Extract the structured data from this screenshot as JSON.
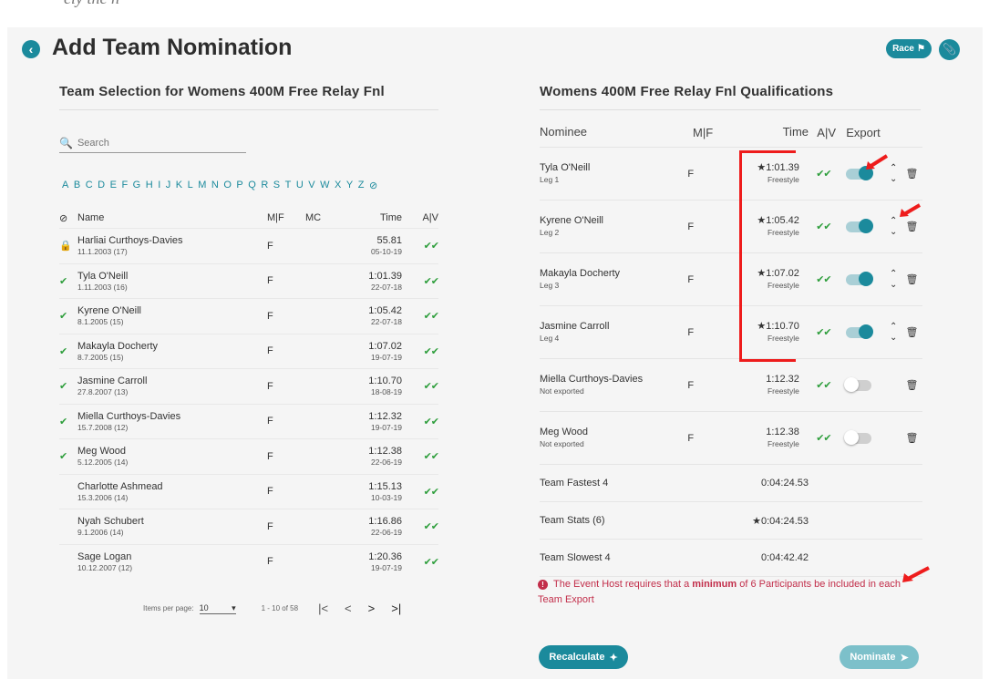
{
  "header": {
    "title": "Add Team Nomination",
    "race_label": "Race",
    "top_fragment": "ely  the  n"
  },
  "left": {
    "section_title": "Team Selection for Womens 400M Free Relay Fnl",
    "search_placeholder": "Search",
    "alphabet": [
      "A",
      "B",
      "C",
      "D",
      "E",
      "F",
      "G",
      "H",
      "I",
      "J",
      "K",
      "L",
      "M",
      "N",
      "O",
      "P",
      "Q",
      "R",
      "S",
      "T",
      "U",
      "V",
      "W",
      "X",
      "Y",
      "Z"
    ],
    "columns": {
      "name": "Name",
      "mf": "M|F",
      "mc": "MC",
      "time": "Time",
      "av": "A|V"
    },
    "rows": [
      {
        "name": "Harliai Curthoys-Davies",
        "dob": "11.1.2003 (17)",
        "mf": "F",
        "mc": "",
        "time": "55.81",
        "date": "05-10-19",
        "icon": "lock"
      },
      {
        "name": "Tyla O'Neill",
        "dob": "1.11.2003 (16)",
        "mf": "F",
        "mc": "",
        "time": "1:01.39",
        "date": "22-07-18",
        "icon": "check"
      },
      {
        "name": "Kyrene O'Neill",
        "dob": "8.1.2005 (15)",
        "mf": "F",
        "mc": "",
        "time": "1:05.42",
        "date": "22-07-18",
        "icon": "check"
      },
      {
        "name": "Makayla Docherty",
        "dob": "8.7.2005 (15)",
        "mf": "F",
        "mc": "",
        "time": "1:07.02",
        "date": "19-07-19",
        "icon": "check"
      },
      {
        "name": "Jasmine Carroll",
        "dob": "27.8.2007 (13)",
        "mf": "F",
        "mc": "",
        "time": "1:10.70",
        "date": "18-08-19",
        "icon": "check"
      },
      {
        "name": "Miella Curthoys-Davies",
        "dob": "15.7.2008 (12)",
        "mf": "F",
        "mc": "",
        "time": "1:12.32",
        "date": "19-07-19",
        "icon": "check"
      },
      {
        "name": "Meg Wood",
        "dob": "5.12.2005 (14)",
        "mf": "F",
        "mc": "",
        "time": "1:12.38",
        "date": "22-06-19",
        "icon": "check"
      },
      {
        "name": "Charlotte Ashmead",
        "dob": "15.3.2006 (14)",
        "mf": "F",
        "mc": "",
        "time": "1:15.13",
        "date": "10-03-19",
        "icon": ""
      },
      {
        "name": "Nyah Schubert",
        "dob": "9.1.2006 (14)",
        "mf": "F",
        "mc": "",
        "time": "1:16.86",
        "date": "22-06-19",
        "icon": ""
      },
      {
        "name": "Sage Logan",
        "dob": "10.12.2007 (12)",
        "mf": "F",
        "mc": "",
        "time": "1:20.36",
        "date": "19-07-19",
        "icon": ""
      }
    ],
    "pager": {
      "items_label": "Items per page:",
      "items_value": "10",
      "range": "1 - 10 of 58"
    }
  },
  "right": {
    "section_title": "Womens 400M Free Relay Fnl Qualifications",
    "columns": {
      "nominee": "Nominee",
      "mf": "M|F",
      "time": "Time",
      "av": "A|V",
      "export": "Export"
    },
    "rows": [
      {
        "name": "Tyla O'Neill",
        "sub": "Leg 1",
        "mf": "F",
        "time": "1:01.39",
        "star": true,
        "stroke": "Freestyle",
        "exported": true,
        "reorder": true
      },
      {
        "name": "Kyrene O'Neill",
        "sub": "Leg 2",
        "mf": "F",
        "time": "1:05.42",
        "star": true,
        "stroke": "Freestyle",
        "exported": true,
        "reorder": true
      },
      {
        "name": "Makayla Docherty",
        "sub": "Leg 3",
        "mf": "F",
        "time": "1:07.02",
        "star": true,
        "stroke": "Freestyle",
        "exported": true,
        "reorder": true
      },
      {
        "name": "Jasmine Carroll",
        "sub": "Leg 4",
        "mf": "F",
        "time": "1:10.70",
        "star": true,
        "stroke": "Freestyle",
        "exported": true,
        "reorder": true
      },
      {
        "name": "Miella Curthoys-Davies",
        "sub": "Not exported",
        "mf": "F",
        "time": "1:12.32",
        "star": false,
        "stroke": "Freestyle",
        "exported": false,
        "reorder": false
      },
      {
        "name": "Meg Wood",
        "sub": "Not exported",
        "mf": "F",
        "time": "1:12.38",
        "star": false,
        "stroke": "Freestyle",
        "exported": false,
        "reorder": false
      }
    ],
    "stats": [
      {
        "label": "Team Fastest 4",
        "value": "0:04:24.53",
        "star": false
      },
      {
        "label": "Team Stats (6)",
        "value": "0:04:24.53",
        "star": true
      },
      {
        "label": "Team Slowest 4",
        "value": "0:04:42.42",
        "star": false
      }
    ],
    "warning_pre": "The Event Host requires that a ",
    "warning_bold": "minimum",
    "warning_post": " of 6 Participants be included in each Team Export",
    "recalculate_label": "Recalculate",
    "nominate_label": "Nominate"
  },
  "colors": {
    "accent": "#1b8a9c",
    "check": "#2e9e3c",
    "warning": "#c22e4a",
    "annotation": "#ee1c1c"
  }
}
